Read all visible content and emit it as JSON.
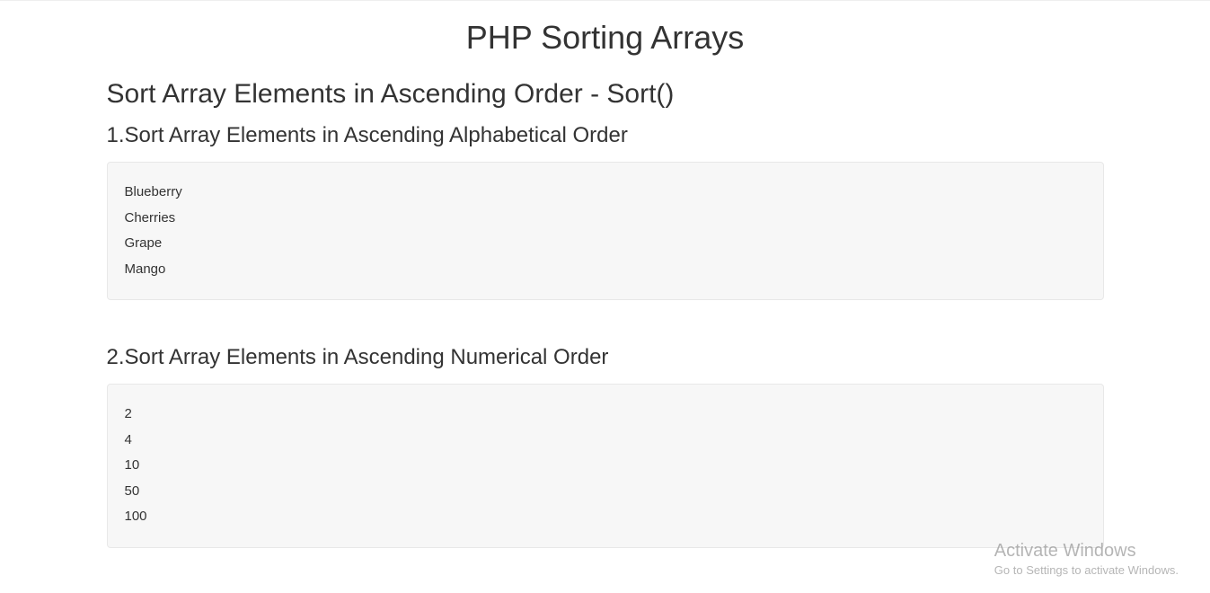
{
  "page_title": "PHP Sorting Arrays",
  "section_heading": "Sort Array Elements in Ascending Order - Sort()",
  "example1": {
    "heading": "1.Sort Array Elements in Ascending Alphabetical Order",
    "items": [
      "Blueberry",
      "Cherries",
      "Grape",
      "Mango"
    ]
  },
  "example2": {
    "heading": "2.Sort Array Elements in Ascending Numerical Order",
    "items": [
      "2",
      "4",
      "10",
      "50",
      "100"
    ]
  },
  "watermark": {
    "line1": "Activate Windows",
    "line2": "Go to Settings to activate Windows."
  }
}
